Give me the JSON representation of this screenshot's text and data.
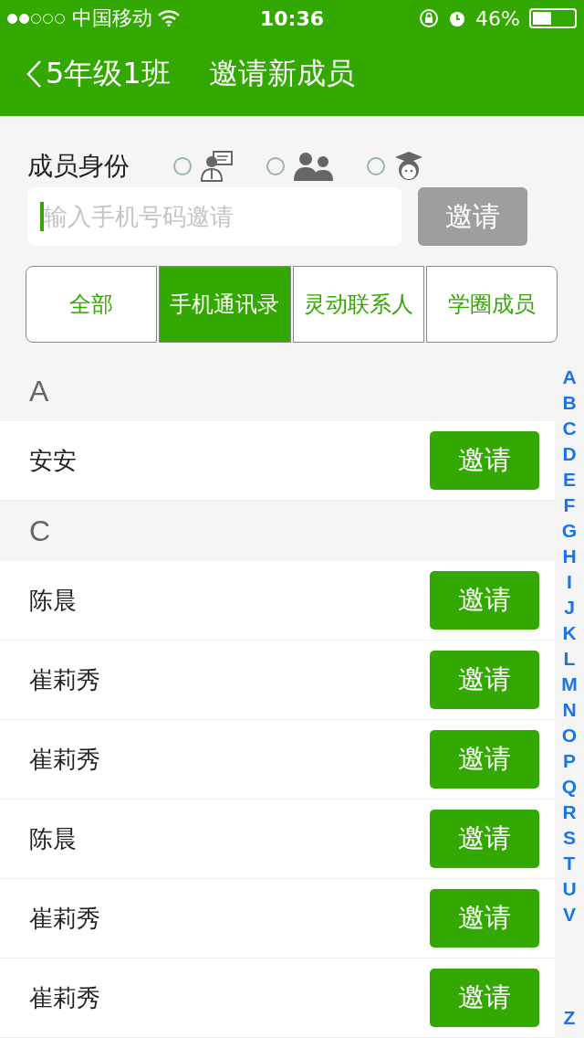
{
  "status_bar": {
    "carrier": "中国移动",
    "time": "10:36",
    "battery": "46%"
  },
  "nav": {
    "back": "5年级1班",
    "title": "邀请新成员"
  },
  "identity": {
    "label": "成员身份",
    "roles": [
      {
        "kind": "teacher",
        "selected": false
      },
      {
        "kind": "parent",
        "selected": false
      },
      {
        "kind": "student",
        "selected": false
      }
    ]
  },
  "invite_field": {
    "placeholder": "输入手机号码邀请",
    "button": "邀请",
    "disabled": true
  },
  "tabs": [
    {
      "label": "全部",
      "selected": false
    },
    {
      "label": "手机通讯录",
      "selected": true
    },
    {
      "label": "灵动联系人",
      "selected": false
    },
    {
      "label": "学圈成员",
      "selected": false
    }
  ],
  "sections": [
    {
      "letter": "A",
      "contacts": [
        {
          "name": "安安",
          "button": "邀请"
        }
      ]
    },
    {
      "letter": "C",
      "contacts": [
        {
          "name": "陈晨",
          "button": "邀请"
        },
        {
          "name": "崔莉秀",
          "button": "邀请"
        },
        {
          "name": "崔莉秀",
          "button": "邀请"
        },
        {
          "name": "陈晨",
          "button": "邀请"
        },
        {
          "name": "崔莉秀",
          "button": "邀请"
        },
        {
          "name": "崔莉秀",
          "button": "邀请"
        }
      ]
    }
  ],
  "index": {
    "letters": [
      "A",
      "B",
      "C",
      "D",
      "E",
      "F",
      "G",
      "H",
      "I",
      "J",
      "K",
      "L",
      "M",
      "N",
      "O",
      "P",
      "Q",
      "R",
      "S",
      "T",
      "U",
      "V"
    ],
    "last": "Z"
  }
}
